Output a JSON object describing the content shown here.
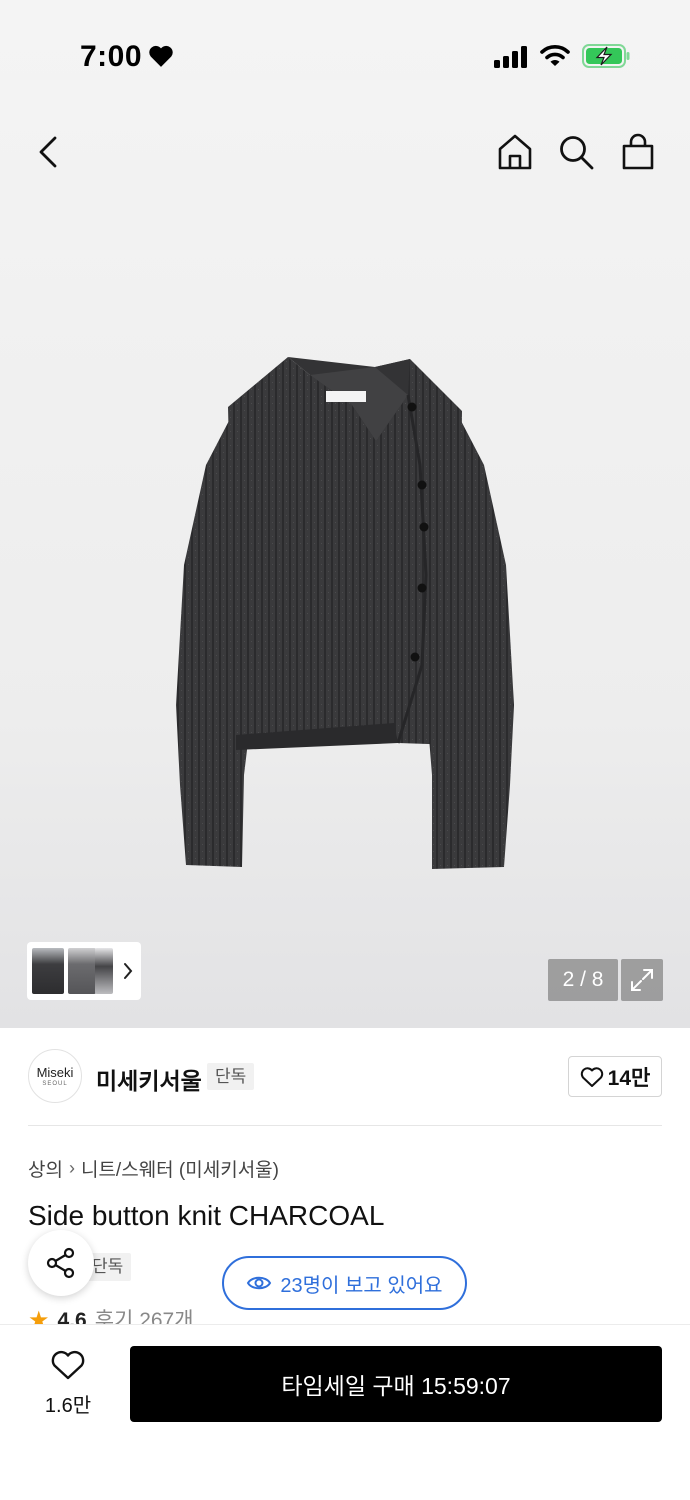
{
  "status_bar": {
    "time": "7:00"
  },
  "header": {
    "back_icon": "chevron-left-icon",
    "home_icon": "home-icon",
    "search_icon": "search-icon",
    "cart_icon": "shopping-bag-icon"
  },
  "gallery": {
    "page_indicator": "2 / 8",
    "expand_icon": "expand-icon"
  },
  "brand": {
    "logo_text": "Miseki",
    "logo_sub": "SEOUL",
    "name": "미세키서울",
    "badge": "단독",
    "likes": "14만"
  },
  "product": {
    "breadcrumb": [
      "상의",
      "니트/스웨터 (미세키서울)"
    ],
    "title": "Side button knit CHARCOAL",
    "exclusive_badge": "단독",
    "rating": "4.6",
    "reviews": "후기 267개"
  },
  "viewers": {
    "text": "23명이 보고 있어요"
  },
  "bottom_bar": {
    "wish_count": "1.6만",
    "buy_label": "타임세일 구매 15:59:07"
  },
  "colors": {
    "accent_blue": "#2f6fdb",
    "star": "#f59e0b",
    "battery_green": "#34c759"
  }
}
